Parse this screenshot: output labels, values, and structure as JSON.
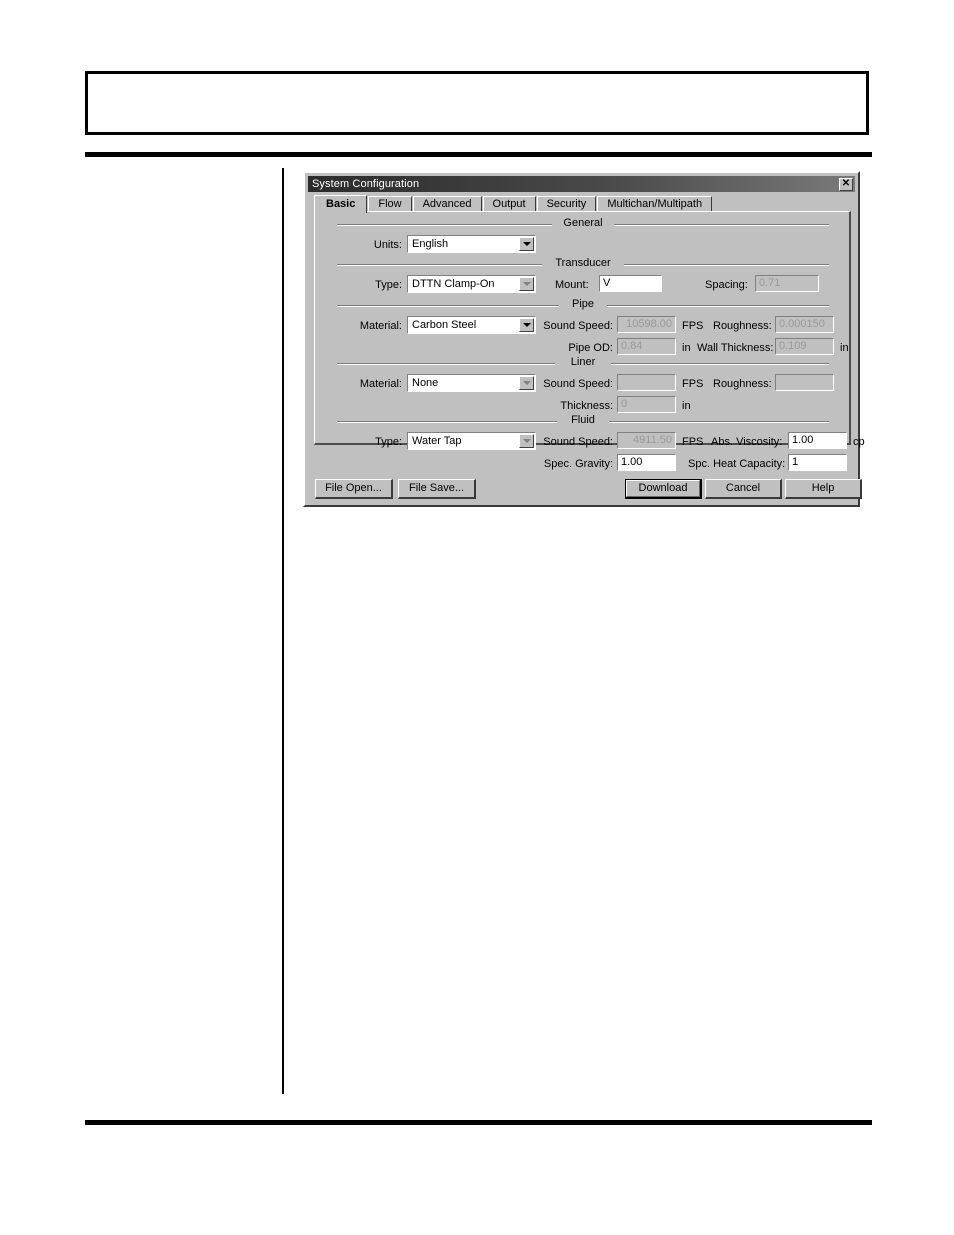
{
  "dialog": {
    "title": "System Configuration",
    "close_label": "✕",
    "tabs": [
      {
        "label": "Basic",
        "active": true
      },
      {
        "label": "Flow",
        "active": false
      },
      {
        "label": "Advanced",
        "active": false
      },
      {
        "label": "Output",
        "active": false
      },
      {
        "label": "Security",
        "active": false
      },
      {
        "label": "Multichan/Multipath",
        "active": false
      }
    ],
    "groups": {
      "general": "General",
      "transducer": "Transducer",
      "pipe": "Pipe",
      "liner": "Liner",
      "fluid": "Fluid"
    },
    "general": {
      "units_label": "Units:",
      "units_value": "English"
    },
    "transducer": {
      "type_label": "Type:",
      "type_value": "DTTN Clamp-On",
      "mount_label": "Mount:",
      "mount_value": "V",
      "spacing_label": "Spacing:",
      "spacing_value": "0.71"
    },
    "pipe": {
      "material_label": "Material:",
      "material_value": "Carbon Steel",
      "sound_speed_label": "Sound Speed:",
      "sound_speed_value": "10598.00",
      "sound_speed_unit": "FPS",
      "roughness_label": "Roughness:",
      "roughness_value": "0.000150",
      "od_label": "Pipe OD:",
      "od_value": "0.84",
      "od_unit": "in",
      "wall_label": "Wall Thickness:",
      "wall_value": "0.109",
      "wall_unit": "in"
    },
    "liner": {
      "material_label": "Material:",
      "material_value": "None",
      "sound_speed_label": "Sound Speed:",
      "sound_speed_value": "",
      "sound_speed_unit": "FPS",
      "roughness_label": "Roughness:",
      "roughness_value": "",
      "thickness_label": "Thickness:",
      "thickness_value": "0",
      "thickness_unit": "in"
    },
    "fluid": {
      "type_label": "Type:",
      "type_value": "Water Tap",
      "sound_speed_label": "Sound Speed:",
      "sound_speed_value": "4911.50",
      "sound_speed_unit": "FPS",
      "viscosity_label": "Abs. Viscosity:",
      "viscosity_value": "1.00",
      "viscosity_unit": "cp",
      "gravity_label": "Spec. Gravity:",
      "gravity_value": "1.00",
      "heat_label": "Spc. Heat Capacity:",
      "heat_value": "1"
    },
    "buttons": {
      "file_open": "File Open...",
      "file_save": "File Save...",
      "download": "Download",
      "cancel": "Cancel",
      "help": "Help"
    }
  }
}
